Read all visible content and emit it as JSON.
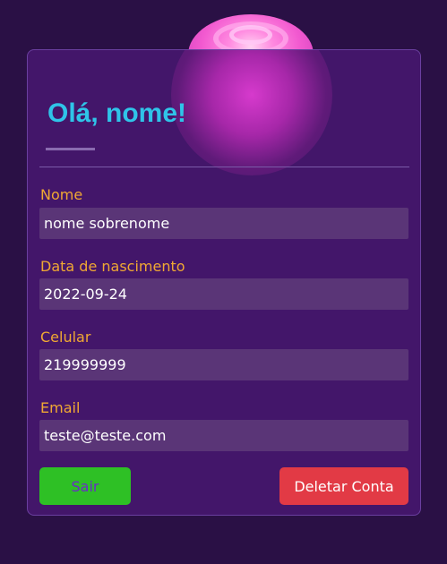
{
  "header": {
    "greeting": "Olá, nome!"
  },
  "fields": [
    {
      "label": "Nome",
      "value": "nome sobrenome"
    },
    {
      "label": "Data de nascimento",
      "value": "2022-09-24"
    },
    {
      "label": "Celular",
      "value": "219999999"
    },
    {
      "label": "Email",
      "value": "teste@teste.com"
    }
  ],
  "actions": {
    "logout_label": "Sair",
    "delete_label": "Deletar Conta"
  },
  "colors": {
    "background": "#2a1045",
    "card": "#43166a",
    "title": "#2fc4e8",
    "label": "#f0a833",
    "input": "#5a3577",
    "logout_button": "#2ec025",
    "delete_button": "#e23a45"
  },
  "icons": {
    "decoration": "pink-blob-decoration"
  }
}
